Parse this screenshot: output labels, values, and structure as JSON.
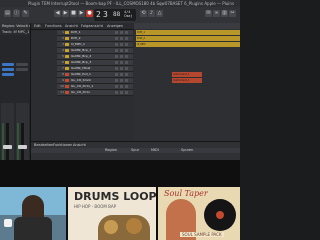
{
  "window": {
    "title": "Plugin TEM Interrupt2tool — Boom-bap PF - ILL_COSMOS180 4b Sqw07BASET 6_Plugins Apple — Pluins"
  },
  "transport": {
    "bar": "2",
    "beat": "3",
    "tempo": "88",
    "sig": "4/4",
    "key": "Cmaj"
  },
  "inspector": {
    "title": "Region: Velocit mnlls tair Allmnt",
    "track_label": "Track: Ilf MPC_1"
  },
  "tabs": [
    "Edit",
    "Functions",
    "Ansicht",
    "Folgeansicht",
    "Anzeigen"
  ],
  "tracks": [
    {
      "num": "1",
      "name": "DrPl_1",
      "color": "#c9a227"
    },
    {
      "num": "2",
      "name": "DrPl_2",
      "color": "#c9a227"
    },
    {
      "num": "3",
      "name": "Ill_MPC_1",
      "color": "#c9a227"
    },
    {
      "num": "4",
      "name": "ILLMtk_Bcp_1",
      "color": "#c9a227"
    },
    {
      "num": "5",
      "name": "ILLMtk_Bcp_2",
      "color": "#c9a227"
    },
    {
      "num": "6",
      "name": "ILLMtk_Bcp_3",
      "color": "#c9a227"
    },
    {
      "num": "7",
      "name": "ILLMtk_Hihat",
      "color": "#c9a227"
    },
    {
      "num": "8",
      "name": "ILLMtk_Pull_1",
      "color": "#c44a2f"
    },
    {
      "num": "9",
      "name": "ILL_CO_Smck",
      "color": "#c44a2f"
    },
    {
      "num": "10",
      "name": "ILL_CO_Dr1x_1",
      "color": "#c44a2f"
    },
    {
      "num": "11",
      "name": "ILL_CO_Dr1x",
      "color": "#c44a2f"
    }
  ],
  "regions": [
    {
      "track": 0,
      "label": "DrPl_1",
      "color": "#c9a227"
    },
    {
      "track": 1,
      "label": "DrPl_2",
      "color": "#c9a227"
    },
    {
      "track": 2,
      "label": "Ill_MPC",
      "color": "#c9a227"
    },
    {
      "track": 7,
      "label": "Instrument_1",
      "color": "#c44a2f"
    },
    {
      "track": 8,
      "label": "Instrument_1",
      "color": "#c44a2f"
    }
  ],
  "lower": {
    "labels": [
      "Bearbeiten",
      "Funktionen",
      "Ansicht",
      "Region",
      "Spur",
      "MIDI"
    ],
    "center": "Spuren"
  },
  "thumbnails": {
    "thumb2_title": "DRUMS LOOP",
    "thumb2_sub": "HIP HOP - BOOM BAP",
    "thumb3_title": "Soul Taper",
    "thumb3_sub": "SOUL SAMPLE PACK"
  },
  "colors": {
    "accent": "#3a76c4",
    "region_yellow": "#c9a227",
    "region_red": "#c44a2f"
  }
}
